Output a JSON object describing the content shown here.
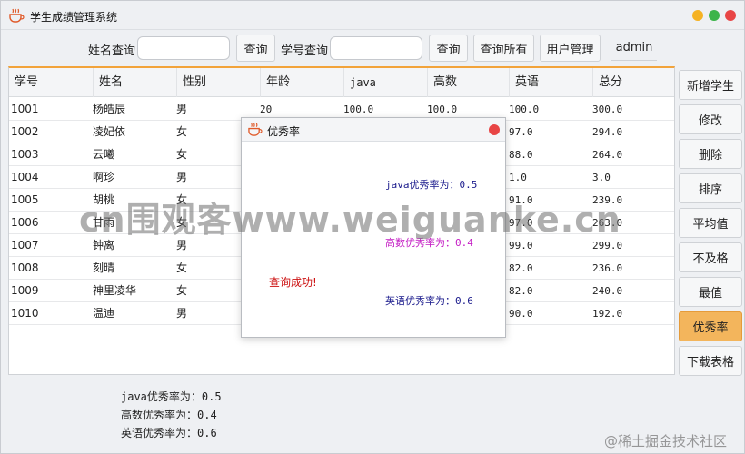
{
  "app": {
    "title": "学生成绩管理系统",
    "icon": "coffee-cup-icon"
  },
  "toolbar": {
    "name_query_label": "姓名查询",
    "name_query_value": "",
    "name_query_button": "查询",
    "id_query_label": "学号查询",
    "id_query_value": "",
    "id_query_button": "查询",
    "query_all_button": "查询所有",
    "user_manage_button": "用户管理",
    "current_user": "admin"
  },
  "table": {
    "columns": [
      "学号",
      "姓名",
      "性别",
      "年龄",
      "java",
      "高数",
      "英语",
      "总分"
    ],
    "rows": [
      [
        "1001",
        "杨皓辰",
        "男",
        "20",
        "100.0",
        "100.0",
        "100.0",
        "300.0"
      ],
      [
        "1002",
        "凌妃依",
        "女",
        "",
        "",
        "",
        "97.0",
        "294.0"
      ],
      [
        "1003",
        "云曦",
        "女",
        "",
        "",
        "",
        "88.0",
        "264.0"
      ],
      [
        "1004",
        "啊珍",
        "男",
        "",
        "",
        "",
        "1.0",
        "3.0"
      ],
      [
        "1005",
        "胡桃",
        "女",
        "",
        "",
        "",
        "91.0",
        "239.0"
      ],
      [
        "1006",
        "甘雨",
        "女",
        "",
        "",
        "",
        "97.0",
        "263.0"
      ],
      [
        "1007",
        "钟离",
        "男",
        "",
        "",
        "",
        "99.0",
        "299.0"
      ],
      [
        "1008",
        "刻晴",
        "女",
        "",
        "",
        "",
        "82.0",
        "236.0"
      ],
      [
        "1009",
        "神里凌华",
        "女",
        "",
        "",
        "",
        "82.0",
        "240.0"
      ],
      [
        "1010",
        "温迪",
        "男",
        "",
        "",
        "",
        "90.0",
        "192.0"
      ]
    ]
  },
  "sidebar": {
    "buttons": [
      "新增学生",
      "修改",
      "删除",
      "排序",
      "平均值",
      "不及格",
      "最值",
      "优秀率",
      "下载表格"
    ],
    "active_index": 7
  },
  "dialog": {
    "title": "优秀率",
    "java_label": "java优秀率为：",
    "java_value": "0.5",
    "math_label": "高数优秀率为：",
    "math_value": "0.4",
    "english_label": "英语优秀率为：",
    "english_value": "0.6",
    "status": "查询成功!",
    "colors": {
      "java": "#1a1a8c",
      "math": "#c41cc4",
      "english": "#1a1a8c",
      "status": "#cc1111"
    }
  },
  "summary": {
    "java": "java优秀率为：0.5",
    "math": "高数优秀率为：0.4",
    "english": "英语优秀率为：0.6"
  },
  "watermark": "cn围观客www.weiguanke.cn",
  "corner_watermark": "@稀土掘金技术社区",
  "colors": {
    "accent": "#f2a33a",
    "active_button": "#f3b55c"
  }
}
